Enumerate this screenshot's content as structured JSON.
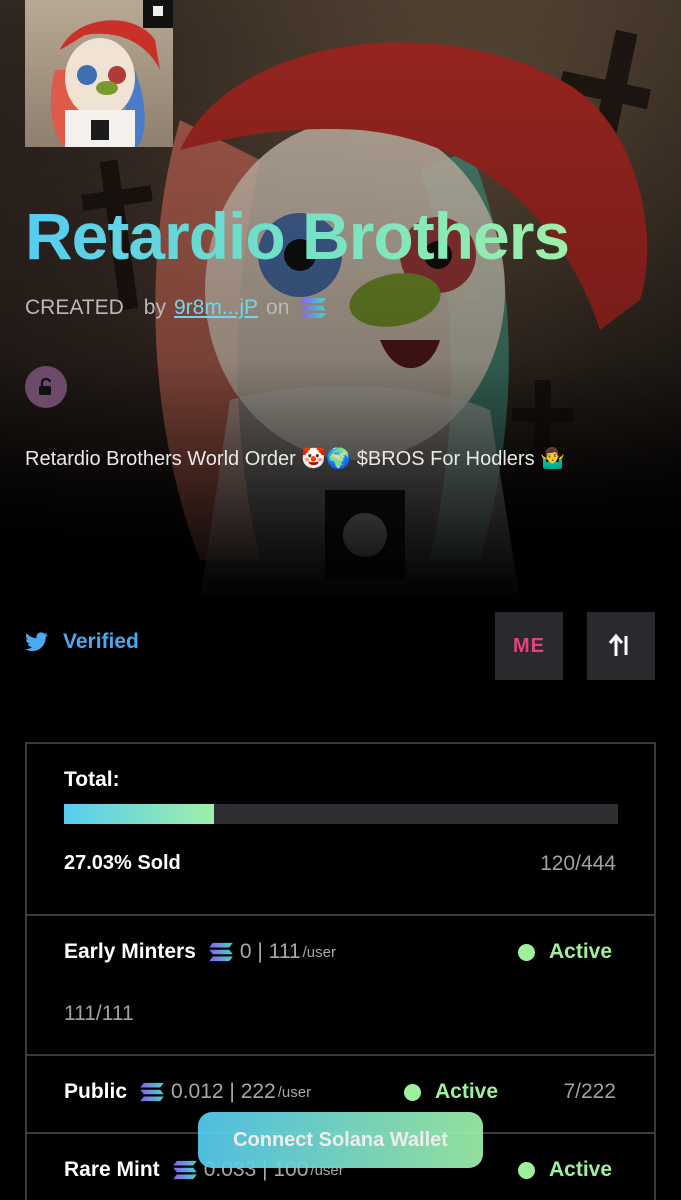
{
  "collection": {
    "title": "Retardio Brothers",
    "status": "CREATED",
    "by_label": "by",
    "creator": "9r8m...jP",
    "on_label": "on",
    "description": "Retardio Brothers World Order 🤡🌍 $BROS For Hodlers 🤷‍♂️"
  },
  "social": {
    "verified_label": "Verified",
    "marketplace_label": "ME"
  },
  "mint": {
    "total_label": "Total:",
    "progress_fraction": 0.2703,
    "sold_label": "27.03% Sold",
    "sold_count": "120/444",
    "phases": [
      {
        "name": "Early Minters",
        "price": "0 | 111",
        "per": "/user",
        "status": "Active",
        "count": "111/111"
      },
      {
        "name": "Public",
        "price": "0.012 | 222",
        "per": "/user",
        "status": "Active",
        "count": "7/222"
      },
      {
        "name": "Rare Mint",
        "price": "0.033 | 100",
        "per": "/user",
        "status": "Active",
        "count": ""
      }
    ]
  },
  "connect_button_label": "Connect Solana Wallet",
  "colors": {
    "accent_start": "#56ccf2",
    "accent_end": "#9ef0a8",
    "active_green": "#9ef09a",
    "twitter_blue": "#4aa9f0",
    "magic_eden_pink": "#e2427d"
  },
  "icons": [
    "lock-open-icon",
    "solana-icon",
    "twitter-icon",
    "magic-eden-icon",
    "swap-arrows-icon",
    "status-dot-icon"
  ]
}
